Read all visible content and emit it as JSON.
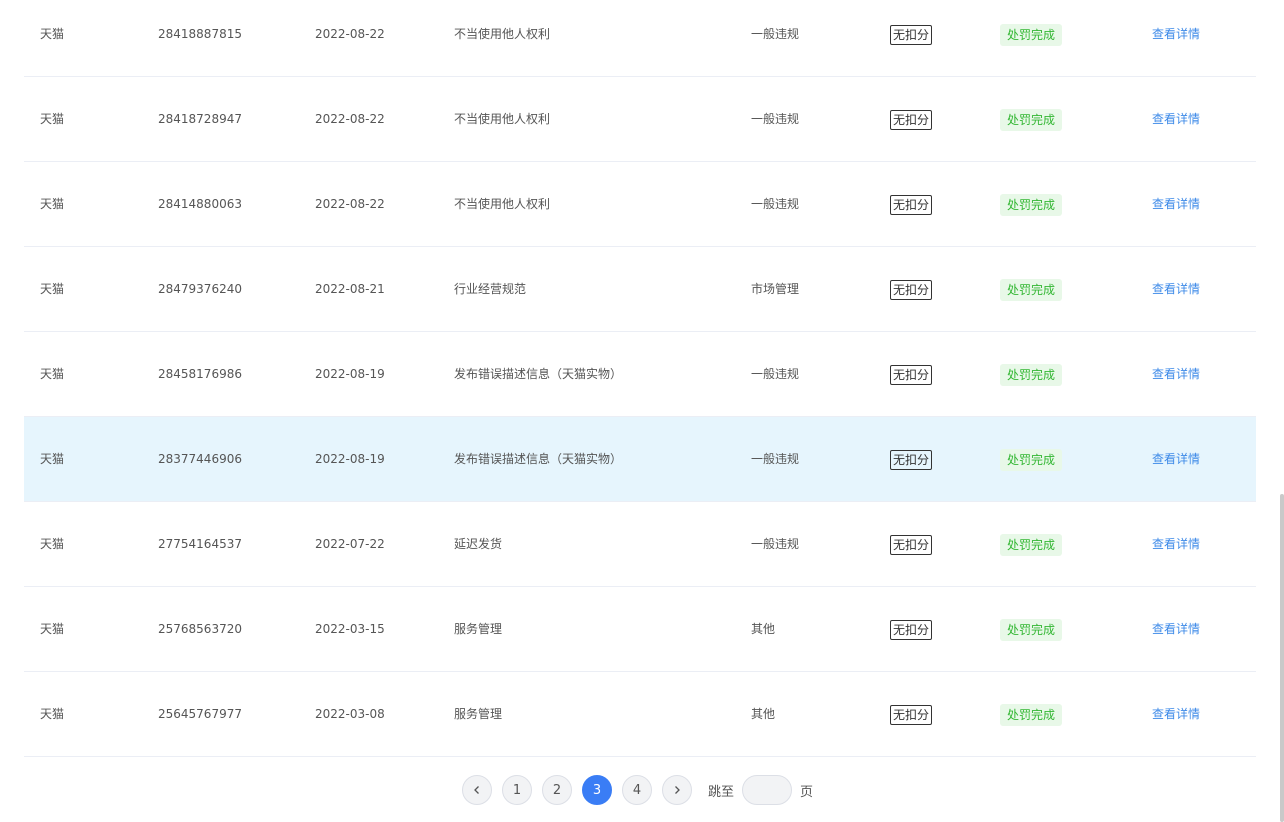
{
  "rows": [
    {
      "platform": "天猫",
      "id": "28418887815",
      "date": "2022-08-22",
      "reason": "不当使用他人权利",
      "type": "一般违规",
      "points": "无扣分",
      "status": "处罚完成",
      "action": "查看详情"
    },
    {
      "platform": "天猫",
      "id": "28418728947",
      "date": "2022-08-22",
      "reason": "不当使用他人权利",
      "type": "一般违规",
      "points": "无扣分",
      "status": "处罚完成",
      "action": "查看详情"
    },
    {
      "platform": "天猫",
      "id": "28414880063",
      "date": "2022-08-22",
      "reason": "不当使用他人权利",
      "type": "一般违规",
      "points": "无扣分",
      "status": "处罚完成",
      "action": "查看详情"
    },
    {
      "platform": "天猫",
      "id": "28479376240",
      "date": "2022-08-21",
      "reason": "行业经营规范",
      "type": "市场管理",
      "points": "无扣分",
      "status": "处罚完成",
      "action": "查看详情"
    },
    {
      "platform": "天猫",
      "id": "28458176986",
      "date": "2022-08-19",
      "reason": "发布错误描述信息（天猫实物）",
      "type": "一般违规",
      "points": "无扣分",
      "status": "处罚完成",
      "action": "查看详情"
    },
    {
      "platform": "天猫",
      "id": "28377446906",
      "date": "2022-08-19",
      "reason": "发布错误描述信息（天猫实物）",
      "type": "一般违规",
      "points": "无扣分",
      "status": "处罚完成",
      "action": "查看详情"
    },
    {
      "platform": "天猫",
      "id": "27754164537",
      "date": "2022-07-22",
      "reason": "延迟发货",
      "type": "一般违规",
      "points": "无扣分",
      "status": "处罚完成",
      "action": "查看详情"
    },
    {
      "platform": "天猫",
      "id": "25768563720",
      "date": "2022-03-15",
      "reason": "服务管理",
      "type": "其他",
      "points": "无扣分",
      "status": "处罚完成",
      "action": "查看详情"
    },
    {
      "platform": "天猫",
      "id": "25645767977",
      "date": "2022-03-08",
      "reason": "服务管理",
      "type": "其他",
      "points": "无扣分",
      "status": "处罚完成",
      "action": "查看详情"
    }
  ],
  "highlighted_row": 5,
  "pagination": {
    "prev_icon": "chevron-left-icon",
    "next_icon": "chevron-right-icon",
    "pages": [
      "1",
      "2",
      "3",
      "4"
    ],
    "current": "3",
    "jump_label": "跳至",
    "jump_value": "",
    "page_suffix": "页"
  },
  "colors": {
    "link": "#3d8ae8",
    "status_bg": "#e8f8e8",
    "status_text": "#33b733",
    "highlight_row": "#e6f5fd",
    "active_page": "#3a7df5"
  }
}
